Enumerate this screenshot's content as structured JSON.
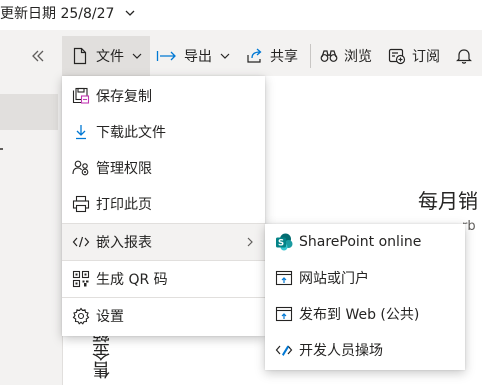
{
  "header": {
    "updated_text": "更新日期 25/8/27"
  },
  "toolbar": {
    "file_label": "文件",
    "export_label": "导出",
    "share_label": "共享",
    "browse_label": "浏览",
    "subscribe_label": "订阅"
  },
  "file_menu": {
    "items": [
      {
        "label": "保存复制",
        "icon": "save-copy-icon"
      },
      {
        "label": "下载此文件",
        "icon": "download-icon"
      },
      {
        "label": "管理权限",
        "icon": "manage-permissions-icon"
      },
      {
        "label": "打印此页",
        "icon": "print-icon"
      },
      {
        "label": "嵌入报表",
        "icon": "embed-code-icon"
      },
      {
        "label": "生成 QR 码",
        "icon": "qr-code-icon"
      },
      {
        "label": "设置",
        "icon": "gear-icon"
      }
    ]
  },
  "embed_submenu": {
    "items": [
      {
        "label": "SharePoint online",
        "icon": "sharepoint-icon"
      },
      {
        "label": "网站或门户",
        "icon": "website-icon"
      },
      {
        "label": "发布到 Web (公共)",
        "icon": "publish-web-icon"
      },
      {
        "label": "开发人员操场",
        "icon": "developer-playground-icon"
      }
    ]
  },
  "report": {
    "title_fragment": "每月销",
    "subtitle_fragment": "rb",
    "axis_label_fragment": "售金额"
  },
  "colors": {
    "accent": "#0078d4",
    "sharepoint": "#038387",
    "menu_hover": "#f3f2f1",
    "toolbar_selected": "#e1dfdd"
  }
}
